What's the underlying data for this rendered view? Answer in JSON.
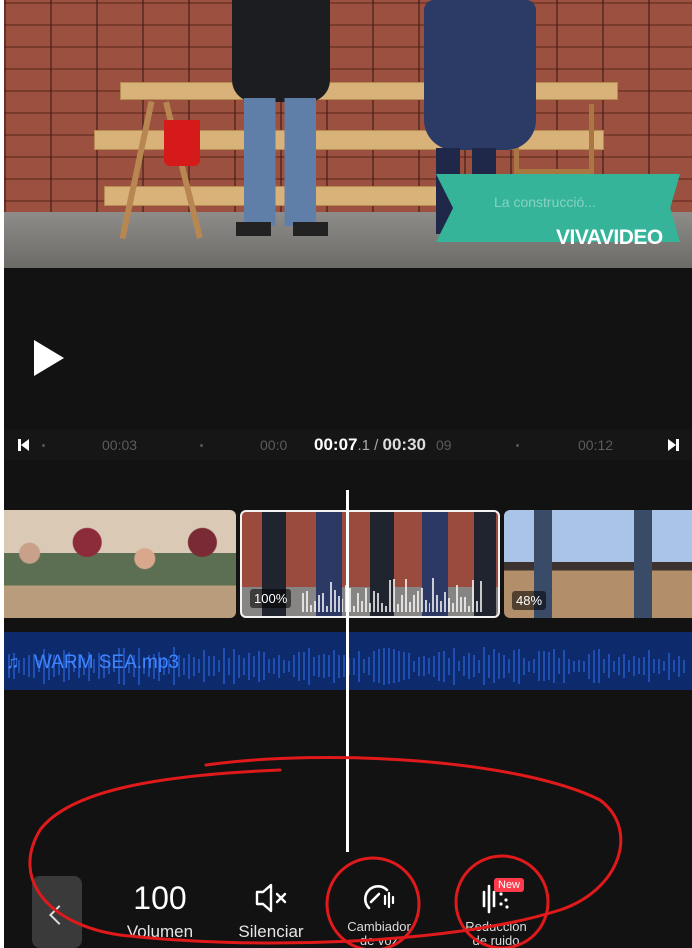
{
  "preview": {
    "banner_text": "La construcció...",
    "watermark": "VIVAVIDEO"
  },
  "player": {
    "play_icon": "play-icon"
  },
  "timeline": {
    "ticks": [
      "00:03",
      "00:0",
      "09",
      "00:12"
    ],
    "current_time": "00:07",
    "fraction": ".1",
    "separator": " / ",
    "total_time": "00:30",
    "skip_start_icon": "skip-start-icon",
    "skip_end_icon": "skip-end-icon"
  },
  "clips": [
    {
      "label": ""
    },
    {
      "label": "100%"
    },
    {
      "label": "48%"
    }
  ],
  "audio": {
    "icon": "music-note-icon",
    "name": "WARM SEA.mp3"
  },
  "toolbar": {
    "back_icon": "chevron-left-icon",
    "volume_value": "100",
    "volume_label": "Volumen",
    "mute_label": "Silenciar",
    "changer_label": "Cambiador",
    "changer_label2": "de voz",
    "noise_label": "Reducción",
    "noise_label2": "de ruido",
    "new_badge": "New"
  },
  "colors": {
    "background": "#121212",
    "audio_track": "#0d2a6c",
    "audio_text": "#3f85ff",
    "banner": "#35b49a",
    "annotation": "#e0191b",
    "new_badge": "#ff3a4a"
  }
}
